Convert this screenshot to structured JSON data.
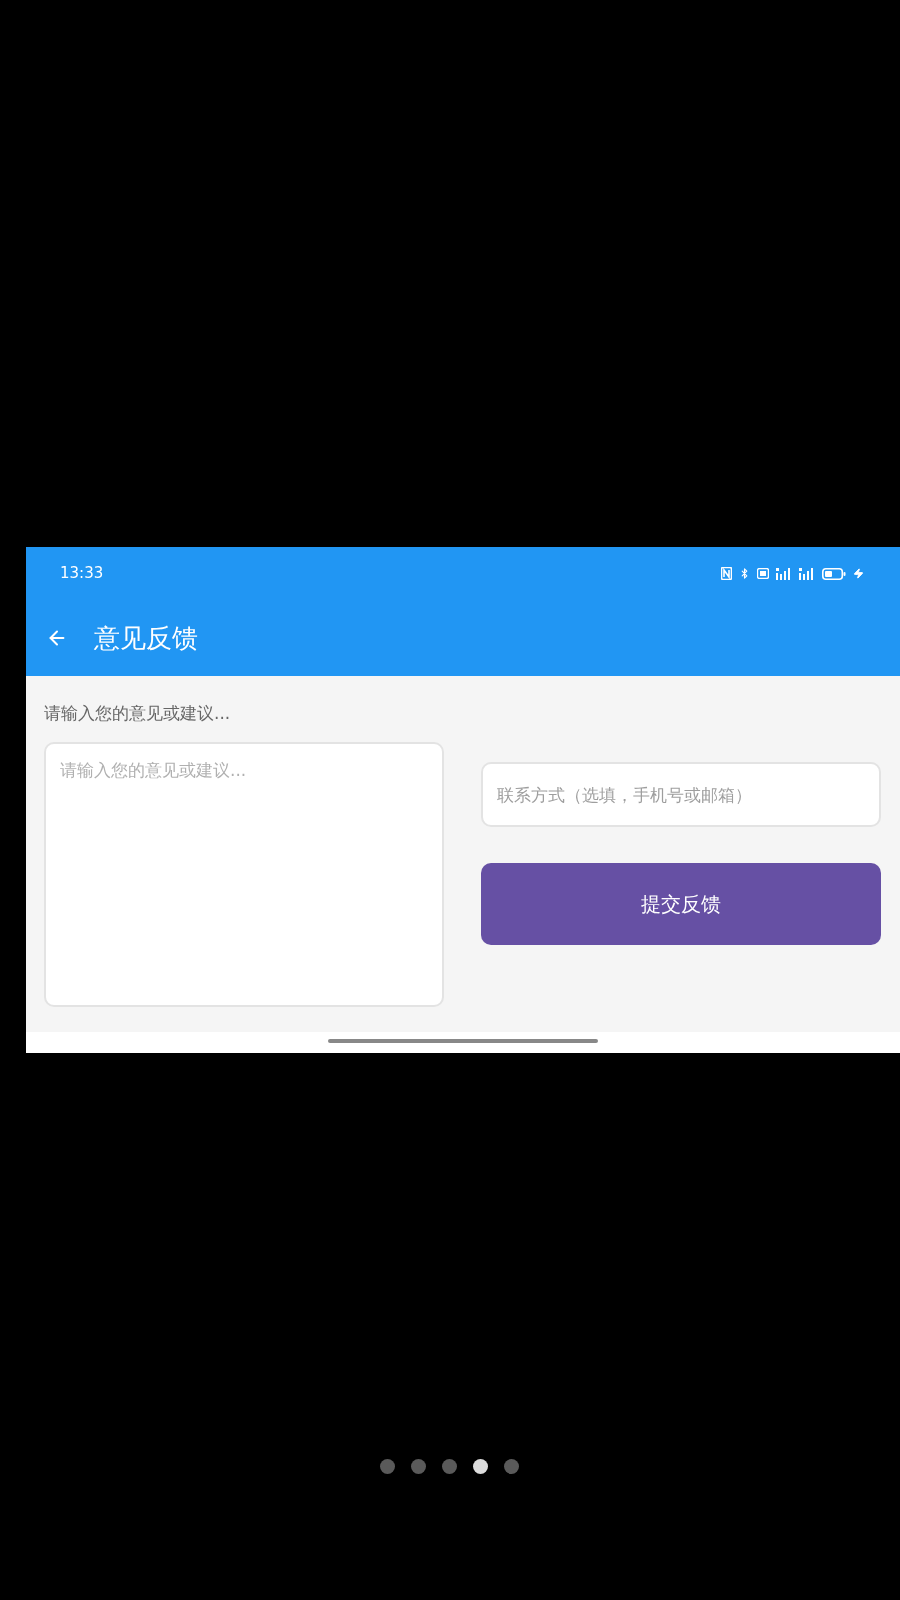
{
  "status_bar": {
    "time": "13:33"
  },
  "app_bar": {
    "title": "意见反馈"
  },
  "form": {
    "label": "请输入您的意见或建议...",
    "feedback_field": {
      "placeholder": "请输入您的意见或建议..."
    },
    "contact_field": {
      "placeholder": "联系方式（选填，手机号或邮箱）"
    },
    "submit_button": "提交反馈"
  },
  "pager": {
    "dots": [
      {
        "selected": false
      },
      {
        "selected": false
      },
      {
        "selected": false
      },
      {
        "selected": true
      },
      {
        "selected": false
      }
    ]
  }
}
